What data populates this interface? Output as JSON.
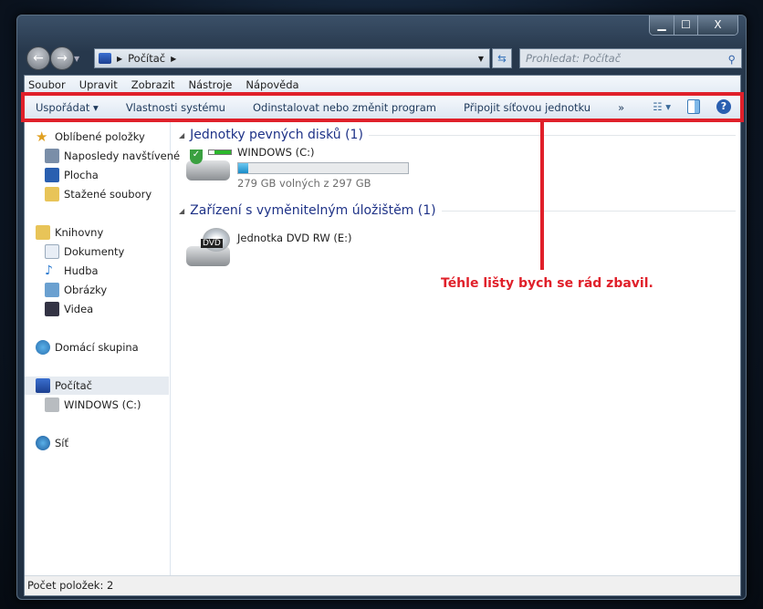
{
  "window": {
    "minimize": "▁",
    "maximize": "☐",
    "close": "X"
  },
  "address": {
    "crumb": "Počítač",
    "search_placeholder": "Prohledat: Počítač"
  },
  "menu": [
    "Soubor",
    "Upravit",
    "Zobrazit",
    "Nástroje",
    "Nápověda"
  ],
  "toolbar": {
    "organize": "Uspořádat ▾",
    "system_properties": "Vlastnosti systému",
    "uninstall": "Odinstalovat nebo změnit program",
    "map_drive": "Připojit síťovou jednotku",
    "more": "»"
  },
  "sidebar": {
    "favorites": "Oblíbené položky",
    "recent": "Naposledy navštívené",
    "desktop": "Plocha",
    "downloads": "Stažené soubory",
    "libraries": "Knihovny",
    "documents": "Dokumenty",
    "music": "Hudba",
    "pictures": "Obrázky",
    "videos": "Videa",
    "homegroup": "Domácí skupina",
    "computer": "Počítač",
    "windows_c": "WINDOWS (C:)",
    "network": "Síť"
  },
  "main": {
    "hdd_group": "Jednotky pevných disků (1)",
    "drive_name": "WINDOWS (C:)",
    "drive_free": "279 GB volných z 297 GB",
    "drive_used_fraction": 0.06,
    "removable_group": "Zařízení s vyměnitelným úložištěm (1)",
    "dvd_name": "Jednotka DVD RW (E:)",
    "dvd_label": "DVD"
  },
  "status": "Počet položek: 2",
  "annotation": "Téhle lišty bych se rád zbavil.",
  "colors": {
    "annotation": "#e0202a",
    "drive_bar": "#26a0da"
  }
}
